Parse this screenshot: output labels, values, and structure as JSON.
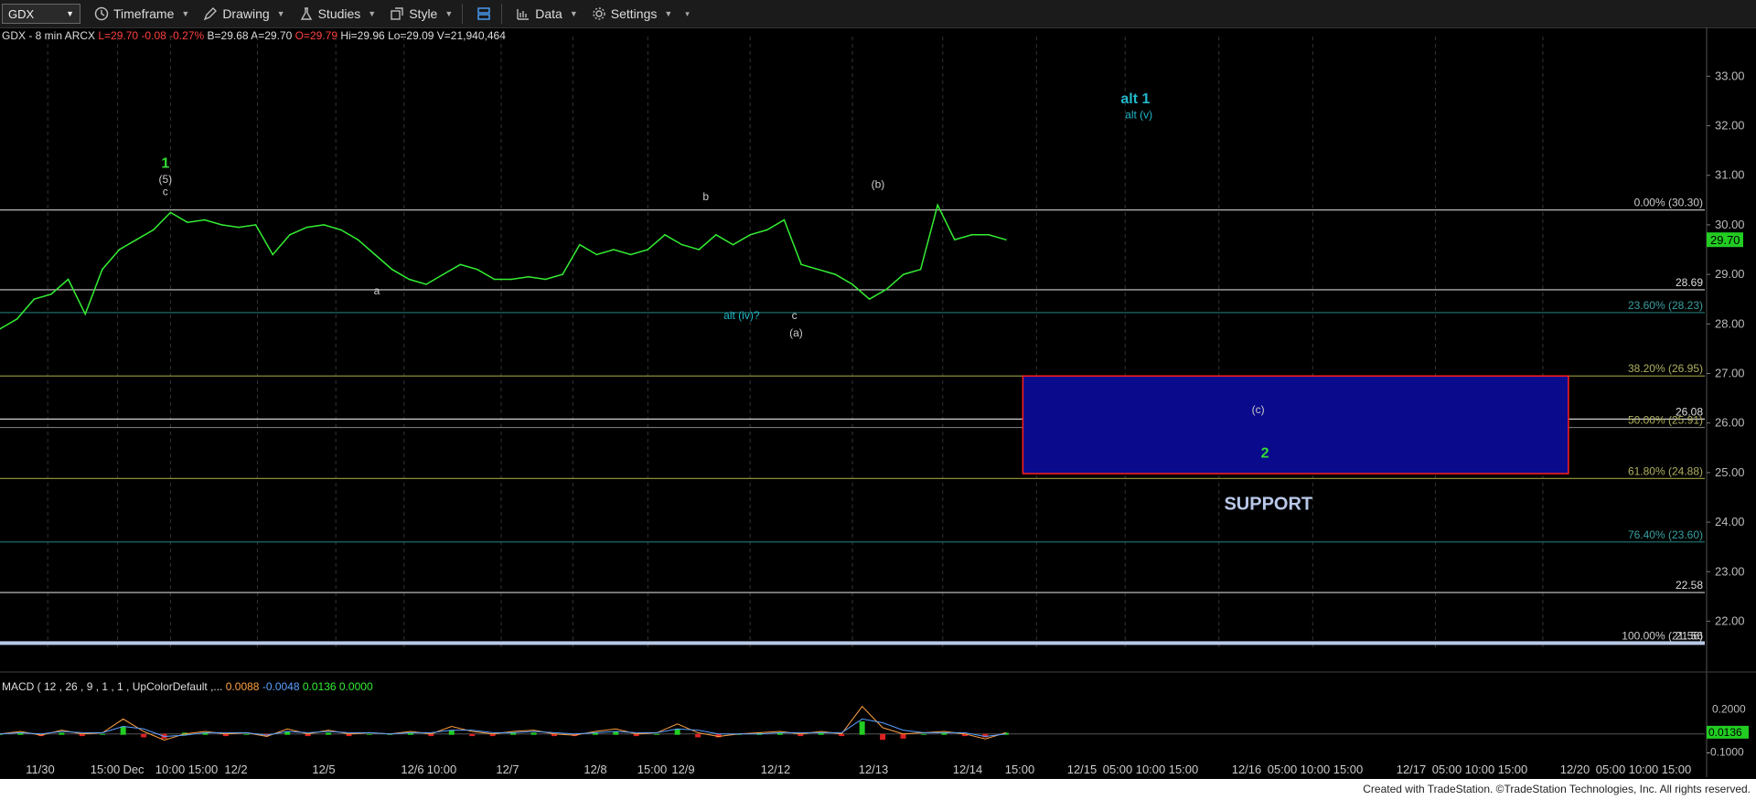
{
  "toolbar": {
    "symbol": "GDX",
    "timeframe": "Timeframe",
    "drawing": "Drawing",
    "studies": "Studies",
    "style": "Style",
    "data": "Data",
    "settings": "Settings"
  },
  "header": {
    "title": "GDX - 8 min  ARCX",
    "last": "L=29.70",
    "change": "-0.08",
    "change_pct": "-0.27%",
    "bid": "B=29.68",
    "ask": "A=29.70",
    "open": "O=29.79",
    "high": "Hi=29.96",
    "low": "Lo=29.09",
    "volume": "V=21,940,464"
  },
  "macd": {
    "title": "MACD ( 12 , 26 , 9 , 1 , 1 , UpColorDefault ,...",
    "v1": "0.0088",
    "v2": "-0.0048",
    "v3": "0.0136",
    "v4": "0.0000",
    "axis_labels": [
      "0.2000",
      "0.0136",
      "-0.1000"
    ]
  },
  "footer": "Created with TradeStation. ©TradeStation Technologies, Inc. All rights reserved.",
  "colors": {
    "price": "#33ee33",
    "fib_line": "#cccccc",
    "support_box": "#0a0a8c",
    "support_border": "#ff2020",
    "wave_green": "#33dd33",
    "wave_teal": "#22b8c8",
    "last_price_bg": "#22cc22"
  },
  "chart_data": {
    "type": "line",
    "ylim": [
      21.4,
      33.8
    ],
    "y_ticks": [
      "33.00",
      "32.00",
      "31.00",
      "30.00",
      "29.00",
      "28.00",
      "27.00",
      "26.00",
      "25.00",
      "24.00",
      "23.00",
      "22.00"
    ],
    "last_price_label": "29.70",
    "x_tick_labels": [
      "11/30",
      "15:00",
      "Dec",
      "10:00",
      "15:00",
      "12/2",
      "12/5",
      "12/6",
      "10:00",
      "12/7",
      "12/8",
      "15:00",
      "12/9",
      "12/12",
      "12/13",
      "12/14",
      "15:00",
      "12/15",
      "05:00",
      "10:00",
      "15:00",
      "12/16",
      "05:00",
      "10:00",
      "15:00",
      "12/17",
      "05:00",
      "10:00",
      "15:00",
      "12/20",
      "05:00",
      "10:00",
      "15:00"
    ],
    "series": [
      {
        "x": [
          0,
          0.01,
          0.02,
          0.03,
          0.04,
          0.05,
          0.06,
          0.07,
          0.08,
          0.09,
          0.1,
          0.11,
          0.12,
          0.13,
          0.14,
          0.15,
          0.16,
          0.17,
          0.18,
          0.19,
          0.2,
          0.21,
          0.22,
          0.23,
          0.24,
          0.25,
          0.26,
          0.27,
          0.28,
          0.29,
          0.3,
          0.31,
          0.32,
          0.33,
          0.34,
          0.35,
          0.36,
          0.37,
          0.38,
          0.39,
          0.4,
          0.41,
          0.42,
          0.43,
          0.44,
          0.45,
          0.46,
          0.47,
          0.48,
          0.49,
          0.5,
          0.51,
          0.52,
          0.53,
          0.54,
          0.55,
          0.56,
          0.57,
          0.58,
          0.59
        ],
        "values": [
          27.9,
          28.1,
          28.5,
          28.6,
          28.9,
          28.2,
          29.1,
          29.5,
          29.7,
          29.9,
          30.25,
          30.05,
          30.1,
          30.0,
          29.95,
          30.0,
          29.4,
          29.8,
          29.95,
          30.0,
          29.9,
          29.7,
          29.4,
          29.1,
          28.9,
          28.8,
          29.0,
          29.2,
          29.1,
          28.9,
          28.9,
          28.95,
          28.9,
          29.0,
          29.6,
          29.4,
          29.5,
          29.4,
          29.5,
          29.8,
          29.6,
          29.5,
          29.8,
          29.6,
          29.8,
          29.9,
          30.1,
          29.2,
          29.1,
          29.0,
          28.8,
          28.5,
          28.7,
          29.0,
          29.1,
          30.4,
          29.7,
          29.8,
          29.8,
          29.7
        ]
      }
    ],
    "fib_levels": [
      {
        "label": "0.00% (30.30)",
        "value": 30.3
      },
      {
        "label": "28.69",
        "value": 28.69
      },
      {
        "label": "23.60% (28.23)",
        "value": 28.23
      },
      {
        "label": "38.20% (26.95)",
        "value": 26.95
      },
      {
        "label": "26.08",
        "value": 26.08
      },
      {
        "label": "50.00% (25.91)",
        "value": 25.91
      },
      {
        "label": "61.80% (24.88)",
        "value": 24.88
      },
      {
        "label": "76.40% (23.60)",
        "value": 23.6
      },
      {
        "label": "22.58",
        "value": 22.58
      },
      {
        "label": "100.00% (21.56)",
        "value": 21.56
      },
      {
        "label": "21.56",
        "value": 21.56
      }
    ],
    "support_zone": {
      "top": 26.95,
      "bottom": 24.98,
      "x_start": 0.6,
      "x_end": 0.92
    },
    "annotations": [
      {
        "text": "1",
        "x": 0.097,
        "y": 31.15,
        "color": "green"
      },
      {
        "text": "(5)",
        "x": 0.097,
        "y": 30.85,
        "color": "white"
      },
      {
        "text": "c",
        "x": 0.097,
        "y": 30.6,
        "color": "white"
      },
      {
        "text": "a",
        "x": 0.221,
        "y": 28.6,
        "color": "white"
      },
      {
        "text": "b",
        "x": 0.414,
        "y": 30.5,
        "color": "white"
      },
      {
        "text": "alt (iv)?",
        "x": 0.435,
        "y": 28.1,
        "color": "teal"
      },
      {
        "text": "c",
        "x": 0.466,
        "y": 28.1,
        "color": "white"
      },
      {
        "text": "(a)",
        "x": 0.467,
        "y": 27.75,
        "color": "white"
      },
      {
        "text": "(b)",
        "x": 0.515,
        "y": 30.75,
        "color": "white"
      },
      {
        "text": "alt 1",
        "x": 0.666,
        "y": 32.45,
        "color": "teal"
      },
      {
        "text": "alt (v)",
        "x": 0.668,
        "y": 32.15,
        "color": "teal"
      },
      {
        "text": "(c)",
        "x": 0.738,
        "y": 26.2,
        "color": "white"
      },
      {
        "text": "2",
        "x": 0.742,
        "y": 25.3,
        "color": "green"
      },
      {
        "text": "SUPPORT",
        "x": 0.744,
        "y": 24.25,
        "color": "support"
      }
    ],
    "macd": {
      "ylim": [
        -0.2,
        0.35
      ],
      "macd_line": [
        0,
        0.02,
        -0.01,
        0.03,
        0.0,
        0.01,
        0.12,
        0.02,
        -0.05,
        0.0,
        0.02,
        0.0,
        0.01,
        -0.02,
        0.04,
        0.0,
        0.03,
        0.0,
        0.01,
        0.0,
        0.02,
        0.0,
        0.06,
        0.02,
        0.0,
        0.02,
        0.03,
        0.0,
        -0.01,
        0.02,
        0.04,
        0.0,
        0.01,
        0.08,
        0.01,
        -0.02,
        0.0,
        0.01,
        0.02,
        0.0,
        0.02,
        0.0,
        0.22,
        0.05,
        0.0,
        0.01,
        0.02,
        0.0,
        -0.04,
        0.01
      ],
      "signal_line": [
        0,
        0.01,
        0.0,
        0.02,
        0.01,
        0.01,
        0.06,
        0.04,
        -0.02,
        -0.01,
        0.01,
        0.01,
        0.01,
        -0.01,
        0.02,
        0.01,
        0.02,
        0.01,
        0.01,
        0.0,
        0.01,
        0.01,
        0.03,
        0.03,
        0.01,
        0.01,
        0.02,
        0.01,
        0.0,
        0.01,
        0.02,
        0.01,
        0.01,
        0.04,
        0.03,
        0.0,
        0.0,
        0.0,
        0.01,
        0.01,
        0.01,
        0.01,
        0.12,
        0.09,
        0.03,
        0.01,
        0.01,
        0.01,
        -0.02,
        0.0
      ]
    }
  }
}
